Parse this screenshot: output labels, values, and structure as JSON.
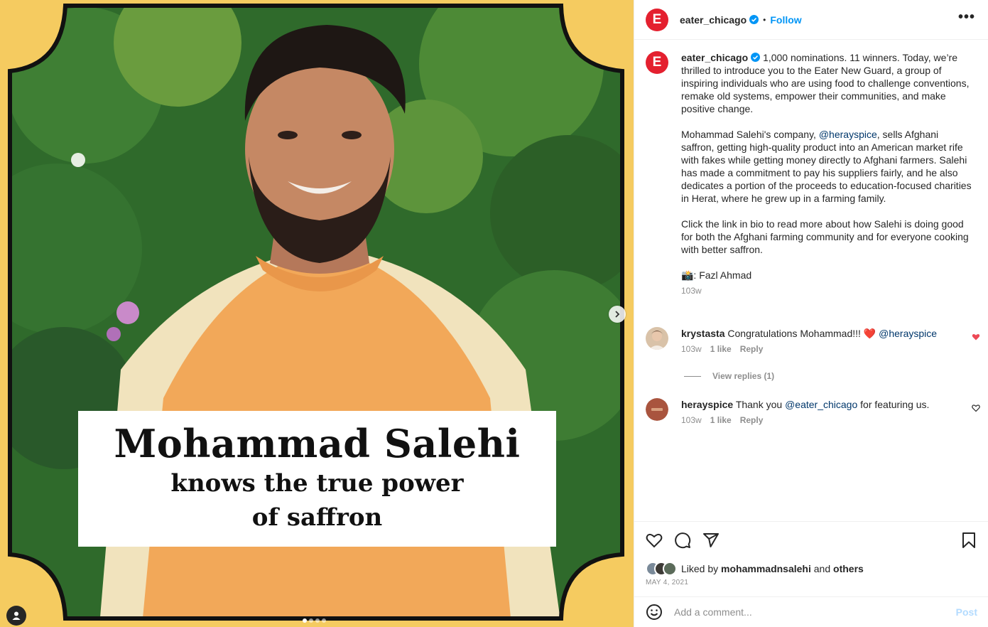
{
  "post": {
    "image": {
      "headline": "Mohammad Salehi",
      "subline_1": "knows the true power",
      "subline_2": "of saffron",
      "carousel_count": 4,
      "carousel_active": 1
    },
    "header": {
      "username": "eater_chicago",
      "follow_label": "Follow",
      "separator": "•",
      "more_label": "•••"
    },
    "caption": {
      "username": "eater_chicago",
      "para1": "1,000 nominations. 11 winners. Today, we’re thrilled to introduce you to the Eater New Guard, a group of inspiring individuals who are using food to challenge conventions, remake old systems, empower their communities, and make positive change.",
      "para2_before": "Mohammad Salehi's company, ",
      "para2_mention": "@herayspice",
      "para2_after": ", sells Afghani saffron, getting high-quality product into an American market rife with fakes while getting money directly to Afghani farmers. Salehi has made a commitment to pay his suppliers fairly, and he also dedicates a portion of the proceeds to education-focused charities in Herat, where he grew up in a farming family.",
      "para3": "Click the link in bio to read more about how Salehi is doing good for both the Afghani farming community and for everyone cooking with better saffron.",
      "credit": "📸: Fazl Ahmad",
      "age": "103w"
    },
    "comments": [
      {
        "username": "krystasta",
        "text": "Congratulations Mohammad!!! ❤️ ",
        "mention": "@herayspice",
        "text_after": "",
        "age": "103w",
        "likes": "1 like",
        "reply": "Reply",
        "liked": true
      },
      {
        "username": "herayspice",
        "text": "Thank you ",
        "mention": "@eater_chicago",
        "text_after": " for featuring us.",
        "age": "103w",
        "likes": "1 like",
        "reply": "Reply",
        "liked": false
      }
    ],
    "view_replies": "View replies (1)",
    "liked_by_prefix": "Liked by ",
    "liked_by_user": "mohammadnsalehi",
    "liked_by_and": " and ",
    "liked_by_others": "others",
    "date": "MAY 4, 2021",
    "comment_placeholder": "Add a comment...",
    "post_label": "Post",
    "avatar_letter": "E"
  },
  "colors": {
    "brand_red": "#e4202f",
    "link_blue": "#0095f6",
    "mention_blue": "#00376b",
    "frame_yellow": "#f5cb60",
    "heart_red": "#ed4956"
  }
}
